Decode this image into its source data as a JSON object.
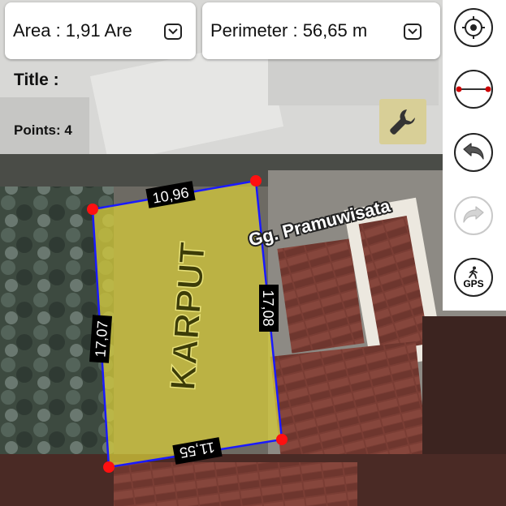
{
  "area": {
    "label": "Area : 1,91 Are"
  },
  "perimeter": {
    "label": "Perimeter : 56,65 m"
  },
  "title": {
    "label": "Title :"
  },
  "points": {
    "label": "Points: 4"
  },
  "plot": {
    "name": "KARPUT",
    "street": "Gg. Pramuwisata",
    "sides": [
      "10,96",
      "17,08",
      "11,55",
      "17,07"
    ],
    "fill_color": "#d6cb3a",
    "edge_color": "#1a1aff",
    "vertex_color": "#ff1010"
  },
  "tools": {
    "locate": "crosshair-target-icon",
    "measure": "measure-line-icon",
    "undo": "undo-icon",
    "redo": "redo-icon",
    "gps": "GPS"
  },
  "settings_icon": "wrench-icon"
}
